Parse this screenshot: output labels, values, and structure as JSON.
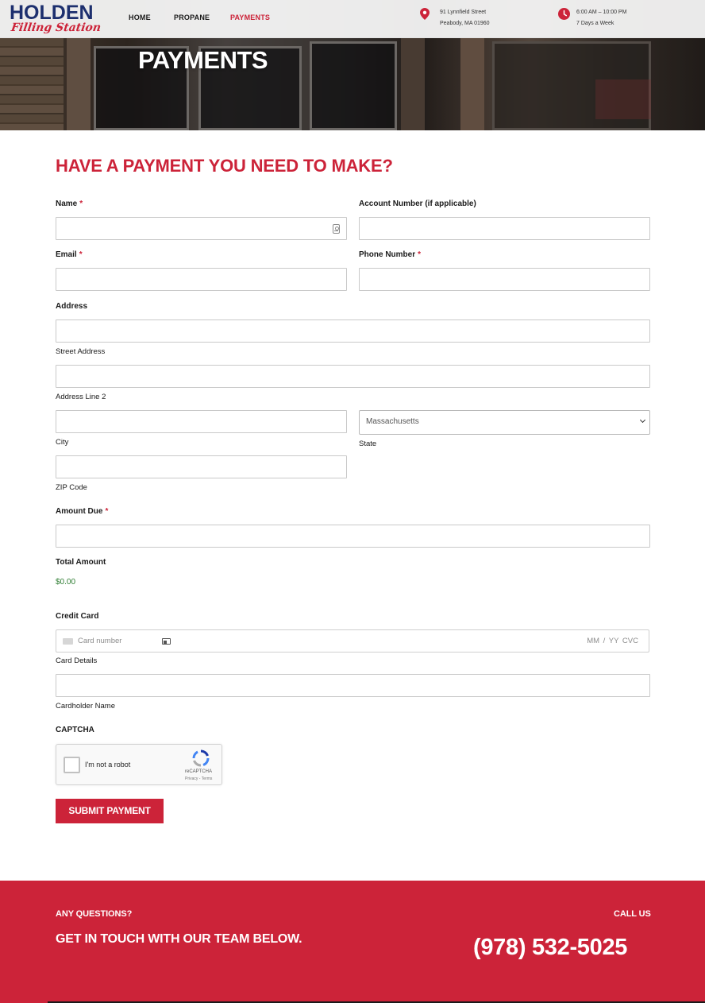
{
  "brand": {
    "name": "HOLDEN",
    "tagline": "Filling Station"
  },
  "nav": {
    "home": "HOME",
    "propane": "PROPANE",
    "payments": "PAYMENTS"
  },
  "location": {
    "line1": "91 Lynnfield Street",
    "line2": "Peabody, MA 01960"
  },
  "hours": {
    "line1": "6:00 AM – 10:00 PM",
    "line2": "7 Days a Week"
  },
  "page_title": "PAYMENTS",
  "form": {
    "heading": "HAVE A PAYMENT YOU NEED TO MAKE?",
    "required_mark": "*",
    "name_label": "Name",
    "account_label": "Account Number (if applicable)",
    "email_label": "Email",
    "phone_label": "Phone Number",
    "address_label": "Address",
    "street_sublabel": "Street Address",
    "line2_sublabel": "Address Line 2",
    "city_sublabel": "City",
    "state_sublabel": "State",
    "state_value": "Massachusetts",
    "zip_sublabel": "ZIP Code",
    "amount_label": "Amount Due",
    "total_label": "Total Amount",
    "total_value": "$0.00",
    "credit_label": "Credit Card",
    "card_placeholder": "Card number",
    "card_expiry_cvc": "MM / YY  CVC",
    "card_sublabel": "Card Details",
    "cardholder_sublabel": "Cardholder Name",
    "captcha_label": "CAPTCHA",
    "captcha_text": "I'm not a robot",
    "captcha_brand": "reCAPTCHA",
    "captcha_links": "Privacy - Terms",
    "submit_label": "SUBMIT PAYMENT"
  },
  "footer": {
    "questions": "ANY QUESTIONS?",
    "touch": "GET IN TOUCH WITH OUR TEAM BELOW.",
    "call_us": "CALL US",
    "phone": "(978) 532-5025"
  },
  "colors": {
    "accent": "#cc2339",
    "brand_blue": "#1d2f6e",
    "total_green": "#2e7d32"
  }
}
